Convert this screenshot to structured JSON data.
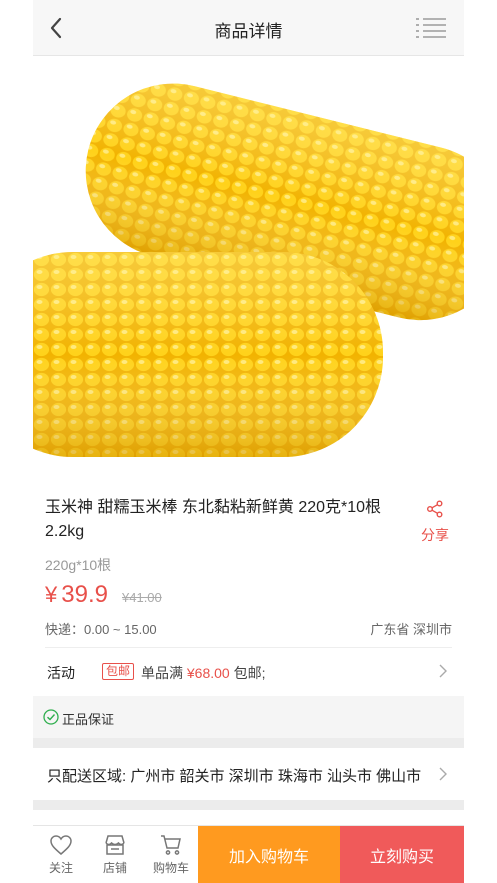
{
  "header": {
    "title": "商品详情",
    "back_icon": "back-arrow-icon",
    "menu_icon": "list-menu-icon"
  },
  "product": {
    "image_icon": "corn-image",
    "title": "玉米神 甜糯玉米棒 东北黏粘新鲜黄 220克*10根 2.2kg",
    "spec": "220g*10根",
    "currency": "¥",
    "price": "39.9",
    "original_price": "¥41.00",
    "shipping": "快递：0.00 ~ 15.00",
    "location": "广东省 深圳市"
  },
  "share": {
    "label": "分享",
    "icon": "share-icon"
  },
  "promotion": {
    "label": "活动",
    "tag": "包邮",
    "text_prefix": "单品满 ",
    "amount": "¥68.00",
    "text_suffix": " 包邮;"
  },
  "guarantee": {
    "text": "正品保证",
    "icon": "check-circle-icon"
  },
  "delivery": {
    "text": "只配送区域: 广州市 韶关市 深圳市 珠海市 汕头市 佛山市"
  },
  "bottom_bar": {
    "follow": "关注",
    "store": "店铺",
    "cart": "购物车",
    "add_to_cart": "加入购物车",
    "buy_now": "立刻购买"
  },
  "colors": {
    "accent_red": "#e8504a",
    "cart_orange": "#ff9a1f",
    "buy_red": "#f05a5a"
  }
}
